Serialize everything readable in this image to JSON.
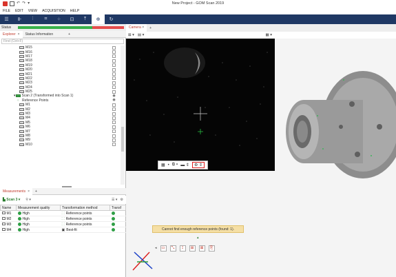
{
  "window": {
    "title": "New Project - GOM Scan 2019"
  },
  "menu": [
    "FILE",
    "EDIT",
    "VIEW",
    "ACQUISITION",
    "HELP"
  ],
  "toolbar": {
    "buttons": [
      "menu-icon",
      "scanner-icon",
      "grid-icon",
      "table-icon",
      "points-icon",
      "frame-icon",
      "export-icon",
      "target-icon",
      "refresh-icon"
    ]
  },
  "status": {
    "label": "Status",
    "progress": 0.7
  },
  "explorer": {
    "tabs": {
      "explorer": "Explorer",
      "status_info": "Status Information",
      "add": "+"
    },
    "find_placeholder": "Find (Ctrl+F)",
    "items": [
      {
        "label": "M15",
        "kind": "point"
      },
      {
        "label": "M16",
        "kind": "point"
      },
      {
        "label": "M17",
        "kind": "point"
      },
      {
        "label": "M18",
        "kind": "point"
      },
      {
        "label": "M19",
        "kind": "point"
      },
      {
        "label": "M20",
        "kind": "point"
      },
      {
        "label": "M21",
        "kind": "point"
      },
      {
        "label": "M22",
        "kind": "point"
      },
      {
        "label": "M23",
        "kind": "point"
      },
      {
        "label": "M24",
        "kind": "point"
      },
      {
        "label": "M25",
        "kind": "point"
      },
      {
        "label": "Scan 2 (Transformed into Scan 1)",
        "kind": "scan"
      },
      {
        "label": "Reference Points",
        "kind": "refs"
      },
      {
        "label": "M1",
        "kind": "point"
      },
      {
        "label": "M2",
        "kind": "point"
      },
      {
        "label": "M3",
        "kind": "point"
      },
      {
        "label": "M4",
        "kind": "point"
      },
      {
        "label": "M5",
        "kind": "point"
      },
      {
        "label": "M6",
        "kind": "point"
      },
      {
        "label": "M7",
        "kind": "point"
      },
      {
        "label": "M8",
        "kind": "point"
      },
      {
        "label": "M9",
        "kind": "point"
      },
      {
        "label": "M10",
        "kind": "point"
      }
    ]
  },
  "measurements": {
    "tabs": {
      "measurements": "Measurements",
      "add": "+"
    },
    "scan_select": "Scan 3",
    "columns": [
      "Name",
      "Measurement quality",
      "Transformation method",
      "Transf"
    ],
    "rows": [
      {
        "name": "M1",
        "quality": "High",
        "method": "Reference points"
      },
      {
        "name": "M2",
        "quality": "High",
        "method": "Reference points"
      },
      {
        "name": "M3",
        "quality": "High",
        "method": "Reference points"
      },
      {
        "name": "M4",
        "quality": "High",
        "method": "Best-fit"
      }
    ]
  },
  "camera": {
    "tab": "Camera",
    "add": "+"
  },
  "viewport": {
    "message": "Cannot find enough reference points (found: 1)."
  },
  "colors": {
    "toolbar": "#1f3864",
    "accent_red": "#d9342b",
    "ok_green": "#2e9e45",
    "warning_bg": "#f5dfa5"
  }
}
